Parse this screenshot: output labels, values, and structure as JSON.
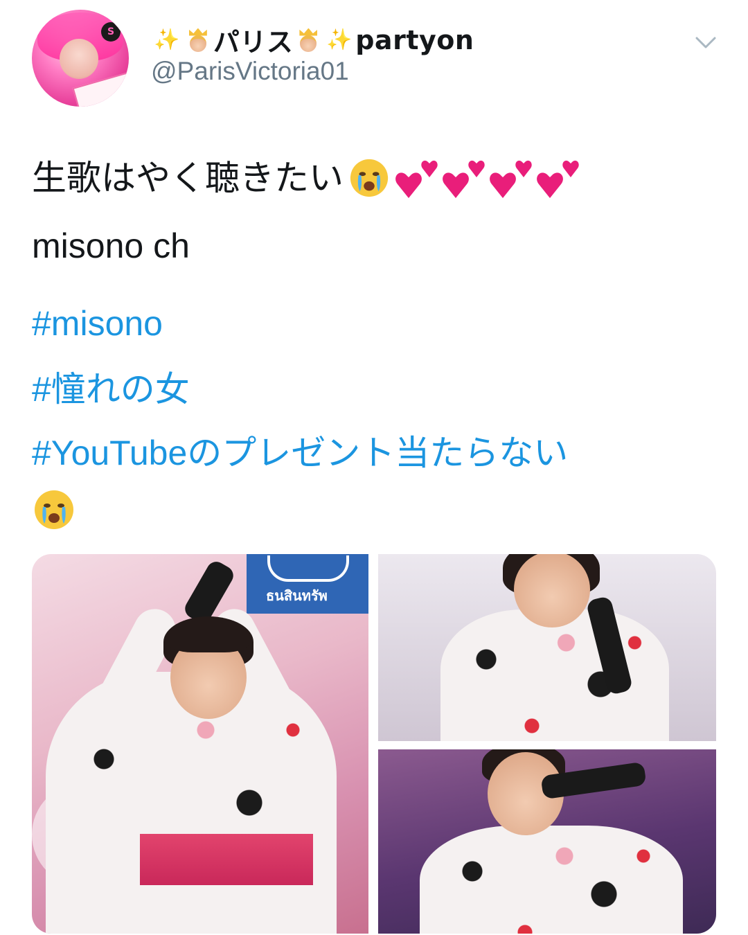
{
  "header": {
    "display_name_left_emoji": "✨",
    "display_name_text": "パリス",
    "display_name_right_emoji": "✨",
    "display_name_suffix": "partyon",
    "handle": "@ParisVictoria01",
    "avatar_badge": "S"
  },
  "tweet": {
    "main_text": "生歌はやく聴きたい",
    "second_line": "misono ch",
    "hashtags": [
      "#misono",
      "#憧れの女",
      "#YouTubeのプレゼント当たらない"
    ]
  },
  "media": {
    "photo_count": 3,
    "banner_text": "ธนสินทรัพ"
  },
  "icons": {
    "menu": "chevron-down-icon",
    "emoji_sequence": [
      "crying-face-icon",
      "two-hearts-icon",
      "two-hearts-icon",
      "two-hearts-icon",
      "two-hearts-icon"
    ],
    "trailing_emoji": "crying-face-icon"
  },
  "colors": {
    "text": "#14171a",
    "handle": "#657786",
    "hashtag": "#1b95e0",
    "heart": "#e91e7a"
  }
}
